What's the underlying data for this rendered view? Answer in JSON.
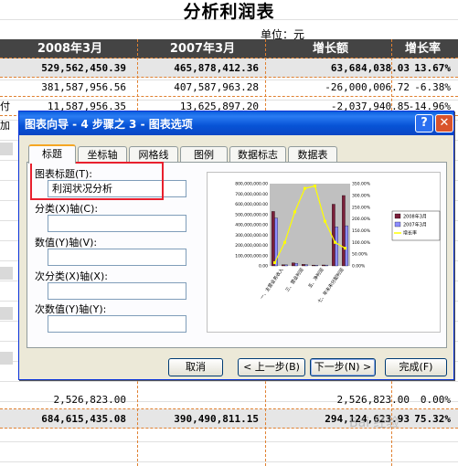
{
  "sheet": {
    "title": "分析利润表",
    "unit": "单位：元",
    "headers": [
      "2008年3月",
      "2007年3月",
      "增长额",
      "增长率"
    ],
    "side_label": "付加",
    "rows": [
      {
        "c1": "529,562,450.39",
        "c2": "465,878,412.36",
        "c3": "63,684,038.03",
        "c4": "13.67%",
        "shade": true,
        "bold": true
      },
      {
        "c1": "381,587,956.56",
        "c2": "407,587,963.28",
        "c3": "-26,000,006.72",
        "c4": "-6.38%",
        "shade": false,
        "bold": false
      },
      {
        "c1": "11,587,956.35",
        "c2": "13,625,897.20",
        "c3": "-2,037,940.85",
        "c4": "-14.96%",
        "shade": false,
        "bold": false
      }
    ],
    "bottom_rows": [
      {
        "c1": "2,526,823.00",
        "c2": "",
        "c3": "2,526,823.00",
        "c4": "0.00%",
        "shade": false,
        "bold": false
      },
      {
        "c1": "684,615,435.08",
        "c2": "390,490,811.15",
        "c3": "294,124,623.93",
        "c4": "75.32%",
        "shade": true,
        "bold": true
      }
    ],
    "watermark": "Bai 经验"
  },
  "dialog": {
    "title": "图表向导 - 4 步骤之 3 - 图表选项",
    "help": "?",
    "close": "✕",
    "tabs": [
      "标题",
      "坐标轴",
      "网格线",
      "图例",
      "数据标志",
      "数据表"
    ],
    "active_tab": 0,
    "fields": {
      "chart_title_label": "图表标题(T):",
      "chart_title_value": "利润状况分析",
      "x_axis_label": "分类(X)轴(C):",
      "x_axis_value": "",
      "y_axis_label": "数值(Y)轴(V):",
      "y_axis_value": "",
      "x2_axis_label": "次分类(X)轴(X):",
      "x2_axis_value": "",
      "y2_axis_label": "次数值(Y)轴(Y):",
      "y2_axis_value": ""
    },
    "buttons": {
      "cancel": "取消",
      "back": "< 上一步(B)",
      "next": "下一步(N) >",
      "finish": "完成(F)"
    }
  },
  "chart_data": {
    "type": "bar",
    "categories": [
      "一、主营业务收入",
      "三、营业利润",
      "五、净利润",
      "七、年末未分配利润"
    ],
    "series": [
      {
        "name": "2008年3月",
        "type": "bar",
        "axis": "left",
        "color": "#7b1f3a",
        "values": [
          529562450,
          12000000,
          30000000,
          15000000,
          8000000,
          9000000,
          600000000,
          684615435
        ]
      },
      {
        "name": "2007年3月",
        "type": "bar",
        "axis": "left",
        "color": "#8c8cff",
        "values": [
          465878412,
          10000000,
          25000000,
          12000000,
          7000000,
          8000000,
          380000000,
          390490811
        ]
      },
      {
        "name": "增长率",
        "type": "line",
        "axis": "right",
        "color": "#ffff00",
        "values": [
          0.1367,
          1.0,
          2.3,
          3.3,
          3.4,
          1.9,
          1.0,
          0.7532
        ]
      }
    ],
    "bar_slots": 8,
    "left_ticks": [
      "800,000,000.00",
      "700,000,000.00",
      "600,000,000.00",
      "500,000,000.00",
      "400,000,000.00",
      "300,000,000.00",
      "200,000,000.00",
      "100,000,000.00",
      "0.00"
    ],
    "right_ticks": [
      "350.00%",
      "300.00%",
      "250.00%",
      "200.00%",
      "150.00%",
      "100.00%",
      "50.00%",
      "0.00%"
    ],
    "ylim": [
      0,
      800000000
    ],
    "y2lim": [
      0,
      3.5
    ],
    "legend_position": "right"
  }
}
